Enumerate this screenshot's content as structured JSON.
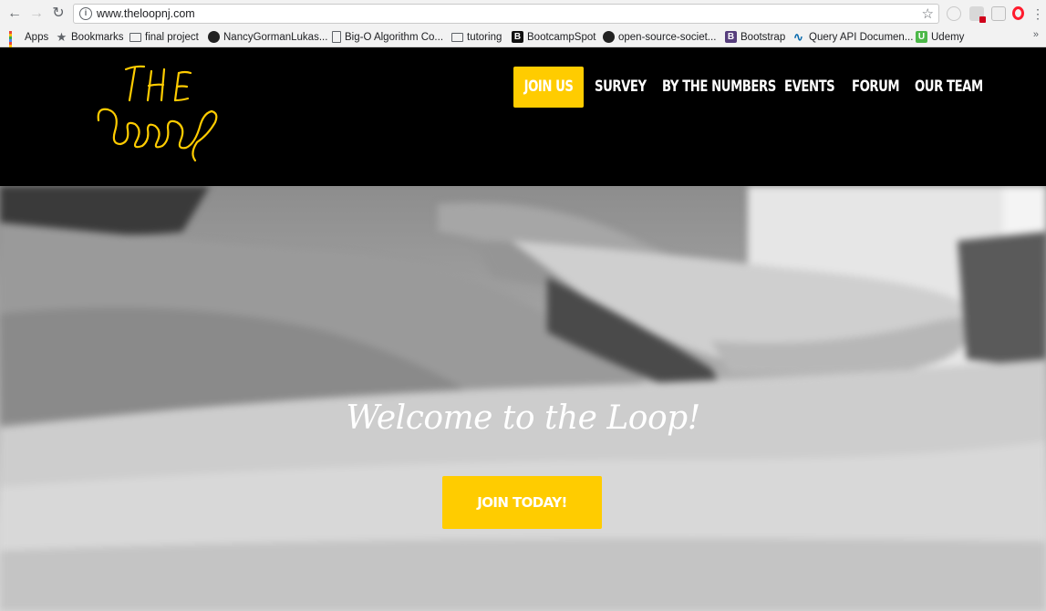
{
  "browser": {
    "url": "www.theloopnj.com",
    "bookmarks": [
      {
        "label": "Apps",
        "icon": "apps-grid-icon"
      },
      {
        "label": "Bookmarks",
        "icon": "star-icon"
      },
      {
        "label": "final project",
        "icon": "folder-icon"
      },
      {
        "label": "NancyGormanLukas...",
        "icon": "github-icon"
      },
      {
        "label": "Big-O Algorithm Co...",
        "icon": "page-icon"
      },
      {
        "label": "tutoring",
        "icon": "folder-icon"
      },
      {
        "label": "BootcampSpot",
        "icon": "bootcampspot-icon"
      },
      {
        "label": "open-source-societ...",
        "icon": "github-icon"
      },
      {
        "label": "Bootstrap",
        "icon": "bootstrap-icon"
      },
      {
        "label": "Query API Documen...",
        "icon": "jquery-icon"
      },
      {
        "label": "Udemy",
        "icon": "udemy-icon"
      }
    ],
    "more": "»"
  },
  "site": {
    "logo": {
      "top": "THE",
      "bottom": "Loop",
      "color": "#ffcc00"
    },
    "nav": {
      "join": "JOIN US",
      "survey": "SURVEY",
      "numbers": "BY THE NUMBERS",
      "events": "EVENTS",
      "forum": "FORUM",
      "team": "OUR TEAM"
    },
    "accent_color": "#ffcc00"
  },
  "hero": {
    "title": "Welcome to the Loop!",
    "cta": "JOIN TODAY!"
  }
}
